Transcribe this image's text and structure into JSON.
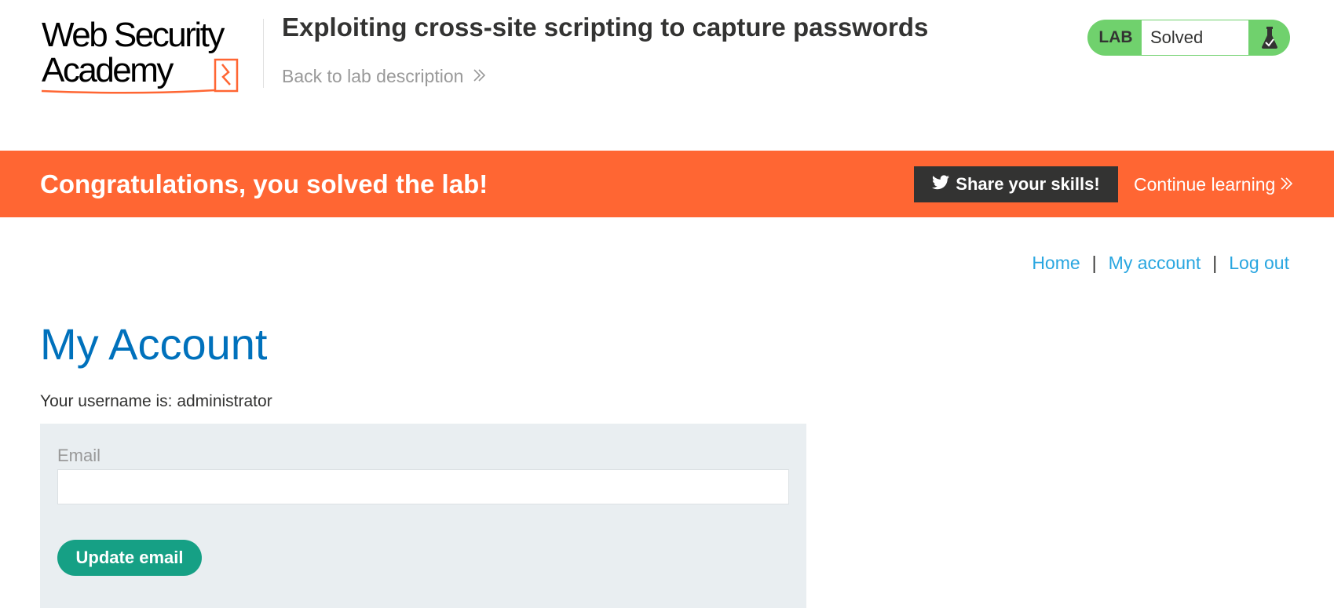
{
  "header": {
    "logo_text": "Web Security Academy",
    "lab_title": "Exploiting cross-site scripting to capture passwords",
    "back_link": "Back to lab description",
    "lab_tag": "LAB",
    "lab_status": "Solved",
    "flask_icon": "flask-check-icon"
  },
  "banner": {
    "message": "Congratulations, you solved the lab!",
    "share_label": "Share your skills!",
    "share_icon": "twitter-icon",
    "continue_label": "Continue learning"
  },
  "nav": {
    "items": [
      "Home",
      "My account",
      "Log out"
    ],
    "separator": "|"
  },
  "account": {
    "title": "My Account",
    "username_line": "Your username is: administrator",
    "email_label": "Email",
    "email_value": "",
    "update_button": "Update email"
  },
  "colors": {
    "banner": "#ff6633",
    "lab_badge": "#70d16d",
    "link": "#29a6e0",
    "title": "#0071bc",
    "button": "#16a085",
    "form_bg": "#e9eef1"
  }
}
